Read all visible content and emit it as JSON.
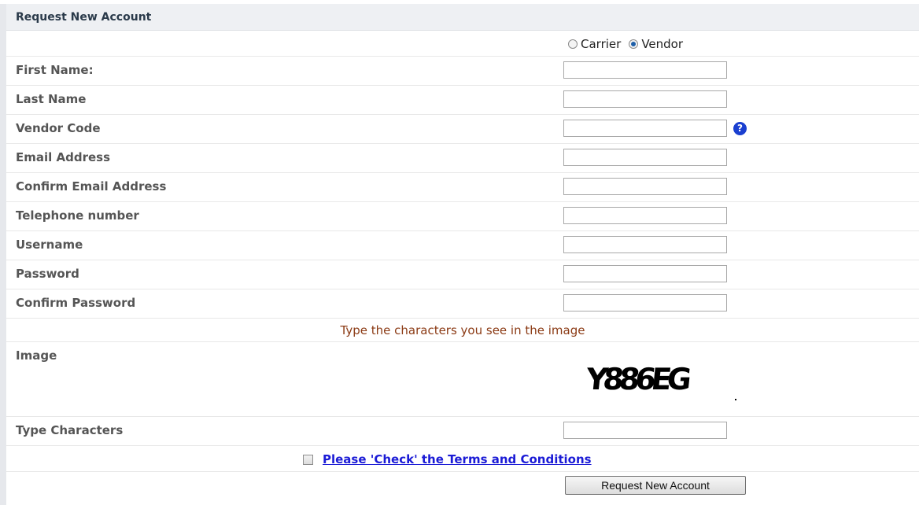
{
  "header": {
    "title": "Request New Account"
  },
  "account_type": {
    "options": [
      {
        "label": "Carrier",
        "selected": false
      },
      {
        "label": "Vendor",
        "selected": true
      }
    ]
  },
  "fields": [
    {
      "label": "First Name:",
      "value": ""
    },
    {
      "label": "Last Name",
      "value": ""
    },
    {
      "label": "Vendor Code",
      "value": "",
      "help_icon": "question-circle-icon"
    },
    {
      "label": "Email Address",
      "value": ""
    },
    {
      "label": "Confirm Email Address",
      "value": ""
    },
    {
      "label": "Telephone number",
      "value": ""
    },
    {
      "label": "Username",
      "value": ""
    },
    {
      "label": "Password",
      "value": ""
    },
    {
      "label": "Confirm Password",
      "value": ""
    }
  ],
  "captcha": {
    "instruction": "Type the characters you see in the image",
    "image_label": "Image",
    "image_text": "Y886EG",
    "type_label": "Type Characters",
    "value": ""
  },
  "terms": {
    "checked": false,
    "link_text": "Please 'Check' the Terms and Conditions"
  },
  "submit": {
    "label": "Request New Account"
  },
  "colors": {
    "header_bg": "#eef0f3",
    "instruction": "#8b3a14",
    "link": "#1b1bd6",
    "help_icon": "#1a3fd0"
  }
}
